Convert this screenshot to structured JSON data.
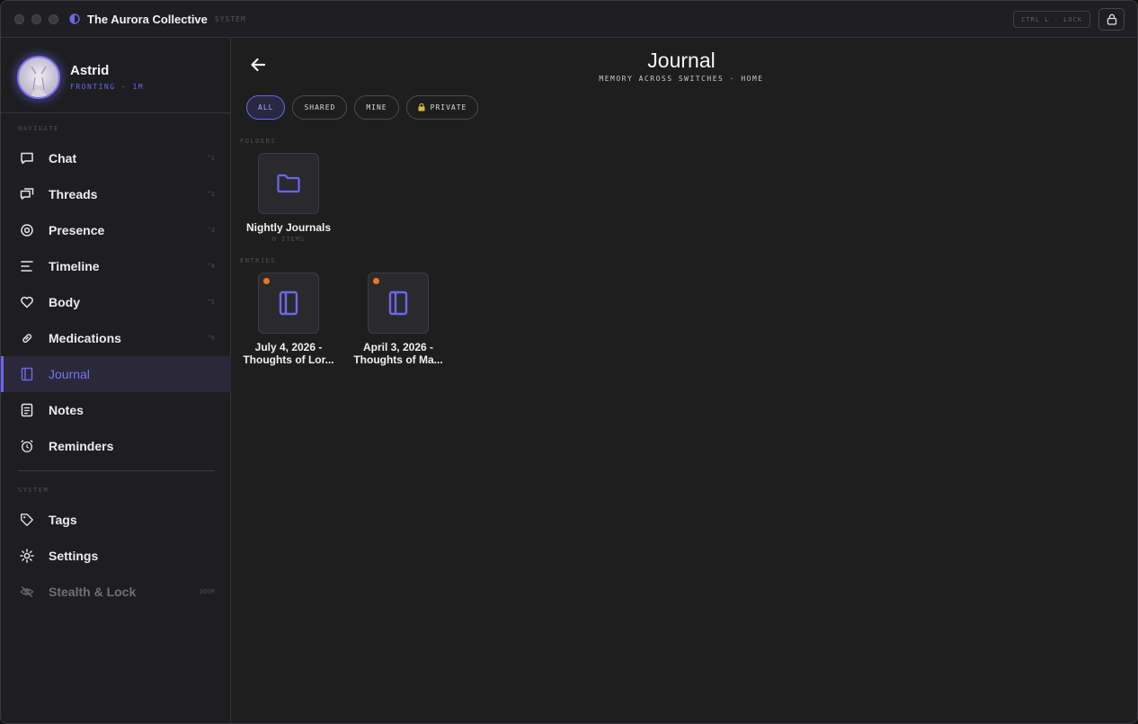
{
  "window": {
    "title": "The Aurora Collective",
    "subtitle": "SYSTEM",
    "lock_hint": "CTRL L · LOCK"
  },
  "profile": {
    "name": "Astrid",
    "status": "FRONTING · 1M"
  },
  "sidebar": {
    "navigate_label": "NAVIGATE",
    "system_label": "SYSTEM",
    "items": [
      {
        "label": "Chat",
        "key": "^1",
        "icon": "chat-icon"
      },
      {
        "label": "Threads",
        "key": "^2",
        "icon": "threads-icon"
      },
      {
        "label": "Presence",
        "key": "^3",
        "icon": "presence-icon"
      },
      {
        "label": "Timeline",
        "key": "^4",
        "icon": "timeline-icon"
      },
      {
        "label": "Body",
        "key": "^5",
        "icon": "heart-icon"
      },
      {
        "label": "Medications",
        "key": "^6",
        "icon": "pill-icon"
      },
      {
        "label": "Journal",
        "key": "",
        "icon": "journal-icon"
      },
      {
        "label": "Notes",
        "key": "",
        "icon": "notes-icon"
      },
      {
        "label": "Reminders",
        "key": "",
        "icon": "alarm-icon"
      }
    ],
    "system_items": [
      {
        "label": "Tags",
        "key": "",
        "icon": "tag-icon"
      },
      {
        "label": "Settings",
        "key": "",
        "icon": "gear-icon"
      },
      {
        "label": "Stealth & Lock",
        "key": "DOOR",
        "icon": "eye-off-icon"
      }
    ],
    "active": "Journal"
  },
  "main": {
    "title": "Journal",
    "subtitle": "MEMORY ACROSS SWITCHES · HOME",
    "filters": [
      {
        "label": "ALL",
        "active": true
      },
      {
        "label": "SHARED",
        "active": false
      },
      {
        "label": "MINE",
        "active": false
      },
      {
        "label": "PRIVATE",
        "active": false,
        "icon": "lock-icon"
      }
    ],
    "folders_label": "FOLDERS",
    "folders": [
      {
        "name": "Nightly Journals",
        "meta": "0 ITEMS"
      }
    ],
    "entries_label": "ENTRIES",
    "entries": [
      {
        "line1": "July 4, 2026 -",
        "line2": "Thoughts of Lor..."
      },
      {
        "line1": "April 3, 2026 -",
        "line2": "Thoughts of Ma..."
      }
    ]
  },
  "colors": {
    "accent": "#6c66e8",
    "unread_dot": "#f2731d",
    "background": "#1e1e1f"
  }
}
